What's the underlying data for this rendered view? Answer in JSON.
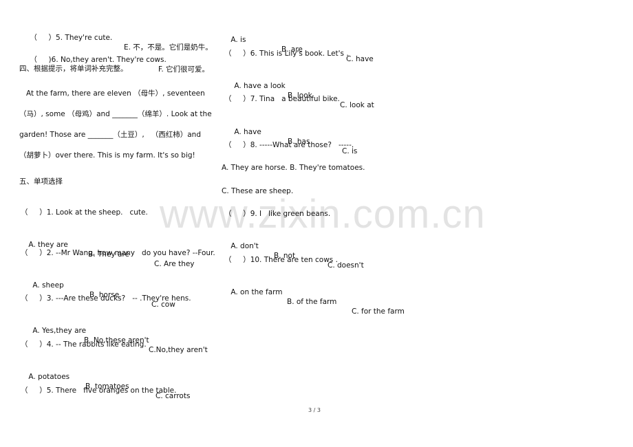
{
  "watermark": "www.zixin.com.cn",
  "left": {
    "match_items": [
      {
        "q": "（     ）5. They're cute.",
        "a": "E. 不，不是。它们是奶牛。"
      },
      {
        "q": "（     )6. No,they aren't. They're cows.",
        "a": "F. 它们很可爱。"
      }
    ],
    "section4_title": "四、根据提示，将单词补充完整。",
    "passage": [
      "   At the farm, there are eleven （母牛）, seventeen",
      "（马）, some （母鸡）and _______（绵羊）. Look at the",
      "garden! Those are _______（土豆）,   （西红柿）and",
      "（胡萝卜）over there. This is my farm. It's so big!"
    ],
    "section5_title": "五、单项选择",
    "questions": [
      {
        "q": "（     ）1. Look at the sheep.   cute.",
        "options": [
          "A. they are",
          "B. They are",
          "C. Are they"
        ]
      },
      {
        "q": "（     ）2. --Mr Wang, how many   do you have? --Four.",
        "options": [
          "A. sheep",
          "B. horse",
          "C. cow"
        ]
      },
      {
        "q": "（     ）3. ---Are these ducks?   -- .They're hens.",
        "options": [
          "A. Yes,they are",
          "B. No,these aren't",
          "C.No,they aren't"
        ]
      },
      {
        "q": "（     ）4. -- The rabbits like eating.",
        "options": [
          "A. potatoes",
          "B. tomatoes",
          "C. carrots"
        ]
      },
      {
        "q": "（     ）5. There   five oranges on the table.",
        "options": []
      }
    ]
  },
  "right": {
    "q5_options": [
      "A. is",
      "B. are",
      "C. have"
    ],
    "questions": [
      {
        "q": "（     ）6. This is Lily's book. Let's .",
        "options": [
          "A. have a look",
          "B. look",
          "C. look at"
        ]
      },
      {
        "q": "（     ）7. Tina   a beautiful bike.",
        "options": [
          "A. have",
          "B. has",
          "C. is"
        ]
      },
      {
        "q": "（     ）8. -----What are those?   -----.",
        "options": [
          "A. They are horse. B. They're tomatoes.",
          "C. These are sheep."
        ]
      },
      {
        "q": "（     ）9. I   like green beans.",
        "options": [
          "A. don't",
          "B. not",
          "C. doesn't"
        ]
      },
      {
        "q": "（     ）10. There are ten cows .",
        "options": [
          "A. on the farm",
          "B. of the farm",
          "C. for the farm"
        ]
      }
    ]
  },
  "footer": {
    "page": "3 / 3"
  }
}
